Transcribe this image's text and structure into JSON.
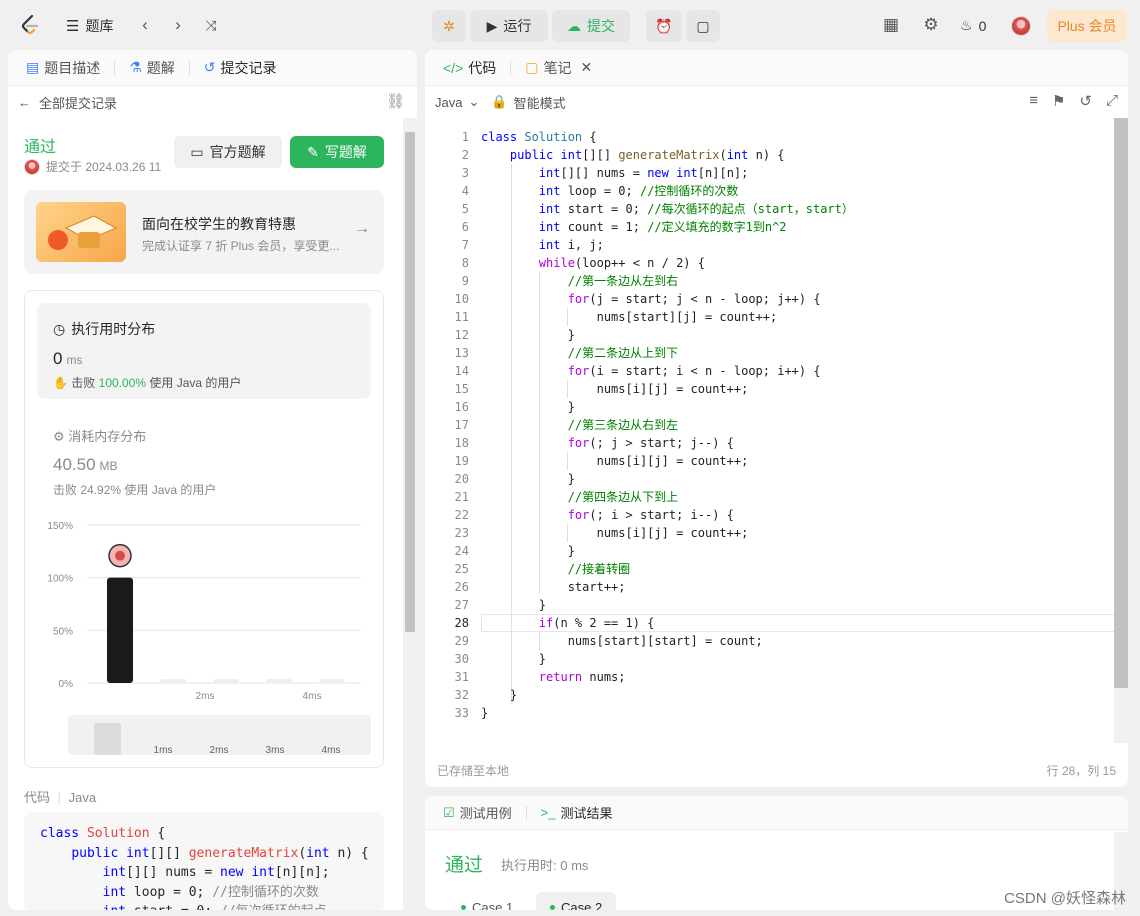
{
  "topbar": {
    "problem_bank": "题库",
    "run": "运行",
    "submit": "提交",
    "fire_count": "0",
    "plus": "Plus 会员"
  },
  "left": {
    "tabs": [
      "题目描述",
      "题解",
      "提交记录"
    ],
    "back": "全部提交记录",
    "status": "通过",
    "submitted_at": "提交于 2024.03.26 11",
    "btn_official": "官方题解",
    "btn_write": "写题解",
    "promo_title": "面向在校学生的教育特惠",
    "promo_sub": "完成认证享 7 折 Plus 会员，享受更...",
    "runtime_title": "执行用时分布",
    "runtime_value": "0",
    "runtime_unit": "ms",
    "runtime_beat_prefix": "击败",
    "runtime_beat_pct": "100.00%",
    "runtime_beat_suffix": "使用 Java 的用户",
    "memory_title": "消耗内存分布",
    "memory_value": "40.50",
    "memory_unit": "MB",
    "memory_beat": "击败 24.92% 使用 Java 的用户",
    "code_label": "代码",
    "code_lang": "Java"
  },
  "chart_data": {
    "type": "bar",
    "categories": [
      "0ms",
      "1ms",
      "2ms",
      "3ms",
      "4ms"
    ],
    "values": [
      100,
      0,
      0,
      0,
      0
    ],
    "y_ticks": [
      "150%",
      "100%",
      "50%",
      "0%"
    ],
    "x_ticks": [
      "2ms",
      "4ms"
    ],
    "range_ticks": [
      "1ms",
      "2ms",
      "3ms",
      "4ms"
    ],
    "ylim": [
      0,
      150
    ],
    "grid": true
  },
  "editor": {
    "tab_code": "代码",
    "tab_notes": "笔记",
    "lang": "Java",
    "mode": "智能模式",
    "saved": "已存储至本地",
    "position": "行 28，列 15"
  },
  "test": {
    "tab_cases": "测试用例",
    "tab_results": "测试结果",
    "result": "通过",
    "time": "执行用时: 0 ms",
    "case1": "Case 1",
    "case2": "Case 2"
  },
  "watermark": "CSDN @妖怪森林"
}
